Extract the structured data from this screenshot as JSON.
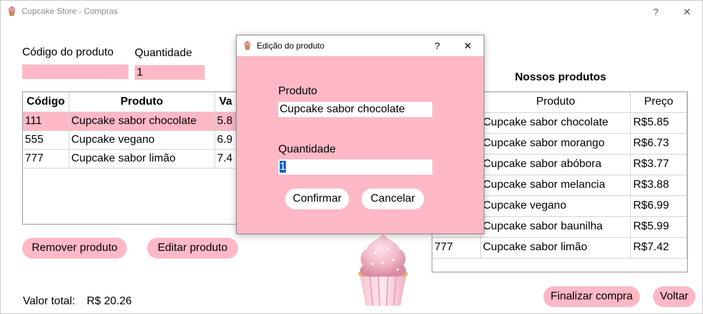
{
  "window": {
    "title": "Cupcake Store - Compras",
    "help_glyph": "?",
    "close_glyph": "✕"
  },
  "form": {
    "code_label": "Código do produto",
    "code_value": "",
    "qty_label": "Quantidade",
    "qty_value": "1"
  },
  "cart": {
    "columns": [
      "Código",
      "Produto",
      "Va"
    ],
    "rows": [
      {
        "code": "111",
        "product": "Cupcake sabor chocolate",
        "value": "5.8"
      },
      {
        "code": "555",
        "product": "Cupcake vegano",
        "value": "6.9"
      },
      {
        "code": "777",
        "product": "Cupcake sabor limão",
        "value": "7.4"
      }
    ],
    "selected_row": 0
  },
  "buttons": {
    "remove": "Remover produto",
    "edit": "Editar produto",
    "finish": "Finalizar compra",
    "back": "Voltar"
  },
  "total": {
    "label": "Valor total:",
    "value": "R$ 20.26"
  },
  "products": {
    "title": "Nossos produtos",
    "columns": [
      "",
      "Produto",
      "Preço"
    ],
    "rows": [
      {
        "code": "",
        "name": "Cupcake sabor chocolate",
        "price": "R$5.85"
      },
      {
        "code": "",
        "name": "Cupcake sabor morango",
        "price": "R$6.73"
      },
      {
        "code": "",
        "name": "Cupcake sabor abóbora",
        "price": "R$3.77"
      },
      {
        "code": "",
        "name": "Cupcake sabor melancia",
        "price": "R$3.88"
      },
      {
        "code": "",
        "name": "Cupcake vegano",
        "price": "R$6.99"
      },
      {
        "code": "",
        "name": "Cupcake sabor baunilha",
        "price": "R$5.99"
      },
      {
        "code": "777",
        "name": "Cupcake sabor limão",
        "price": "R$7.42"
      }
    ]
  },
  "dialog": {
    "title": "Edição do produto",
    "help_glyph": "?",
    "close_glyph": "✕",
    "product_label": "Produto",
    "product_value": "Cupcake sabor chocolate",
    "qty_label": "Quantidade",
    "qty_value": "1",
    "confirm": "Confirmar",
    "cancel": "Cancelar"
  },
  "colors": {
    "pink_accent": "#ffb8c6",
    "selection_blue": "#0b5fc6"
  }
}
